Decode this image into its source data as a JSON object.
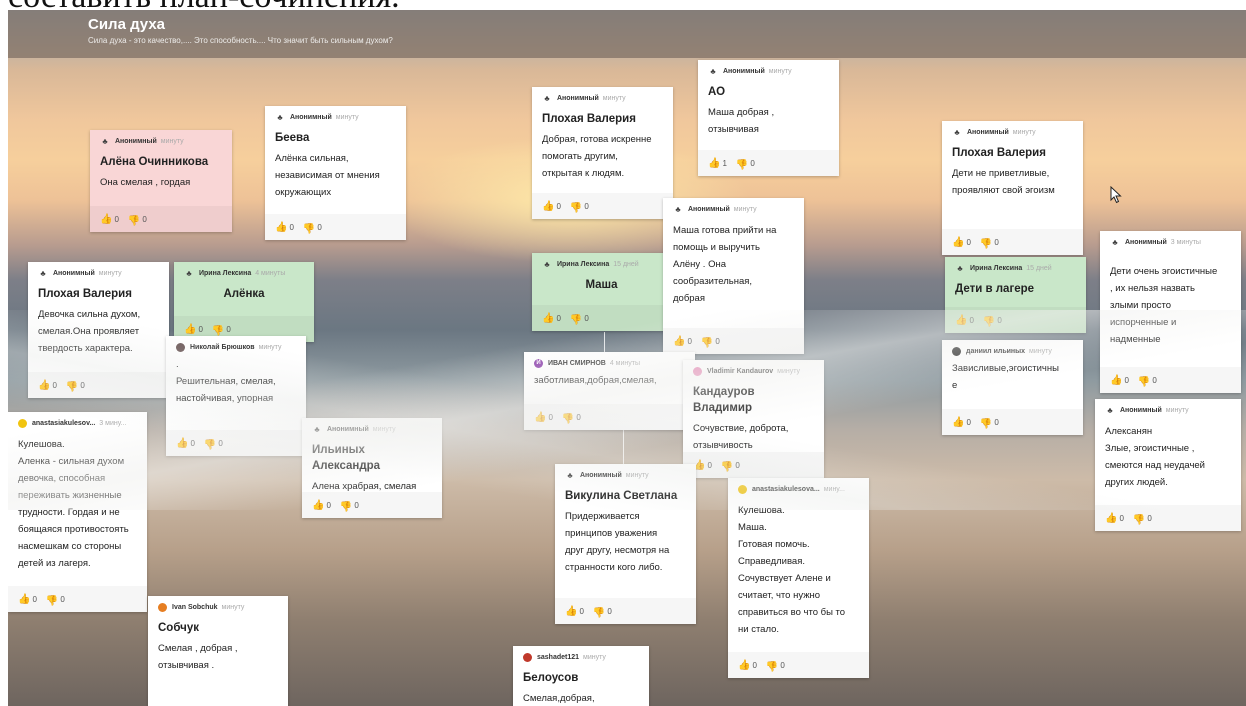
{
  "page_caption": "составить план-сочинения.",
  "board": {
    "title": "Сила духа",
    "subtitle": "Сила духа - это качество,.... Это способность.... Что значит быть сильным духом?"
  },
  "cards": [
    {
      "id": "c1",
      "author": "Анонимный",
      "time": "минуту",
      "title": "Алёна Очинникова",
      "body": "Она смелая , гордая",
      "likes": "0",
      "dislikes": "0"
    },
    {
      "id": "c2",
      "author": "Анонимный",
      "time": "минуту",
      "title": "Беева",
      "body": "Алёнка сильная,\nнезависимая от мнения\nокружающих",
      "likes": "0",
      "dislikes": "0"
    },
    {
      "id": "c3",
      "author": "Анонимный",
      "time": "минуту",
      "title": "Плохая Валерия",
      "body": "Добрая, готова искренне\nпомогать другим,\nоткрытая к людям.",
      "likes": "0",
      "dislikes": "0"
    },
    {
      "id": "c4",
      "author": "Анонимный",
      "time": "минуту",
      "title": "АО",
      "body": "Маша добрая ,\nотзывчивая",
      "likes": "1",
      "dislikes": "0"
    },
    {
      "id": "c5",
      "author": "Анонимный",
      "time": "минуту",
      "title": "Плохая Валерия",
      "body": "Дети не приветливые,\nпроявляют свой эгоизм",
      "likes": "0",
      "dislikes": "0"
    },
    {
      "id": "c6",
      "author": "Анонимный",
      "time": "минуту",
      "title": "Плохая Валерия",
      "body": "Девочка сильна духом,\nсмелая.Она проявляет\nтвердость характера.",
      "likes": "0",
      "dislikes": "0"
    },
    {
      "id": "c7",
      "author": "Ирина Лексина",
      "time": "4 минуты",
      "title": "Алёнка",
      "body": "",
      "likes": "0",
      "dislikes": "0"
    },
    {
      "id": "c8",
      "author": "Николай Брюшков",
      "time": "минуту",
      "title": "",
      "body": ".\nРешительная, смелая,\nнастойчивая, упорная",
      "likes": "0",
      "dislikes": "0"
    },
    {
      "id": "c9",
      "author": "Ирина Лексина",
      "time": "15 дней",
      "title": "Маша",
      "body": "",
      "likes": "0",
      "dislikes": "0"
    },
    {
      "id": "c10",
      "author": "Анонимный",
      "time": "минуту",
      "title": "",
      "body": "Маша готова прийти на\nпомощь и выручить\nАлёну . Она\nсообразительная,\nдобрая",
      "likes": "0",
      "dislikes": "0"
    },
    {
      "id": "c11",
      "author": "Ирина Лексина",
      "time": "15 дней",
      "title": "Дети в лагере",
      "body": "",
      "likes": "0",
      "dislikes": "0"
    },
    {
      "id": "c12",
      "author": "Анонимный",
      "time": "3 минуты",
      "title": "",
      "body": "Дети очень эгоистичные\n, их нельзя назвать\nзлыми просто\nиспорченные и\nнадменные",
      "likes": "0",
      "dislikes": "0"
    },
    {
      "id": "c13",
      "author": "даниил ильиных",
      "time": "минуту",
      "title": "",
      "body": "Зависливые,эгоистичны\nе",
      "likes": "0",
      "dislikes": "0"
    },
    {
      "id": "c14",
      "author": "ИВАН СМИРНОВ",
      "time": "4 минуты",
      "title": "",
      "body": "заботливая,добрая,смелая,",
      "likes": "0",
      "dislikes": "0"
    },
    {
      "id": "c15",
      "author": "Vladimir Kandaurov",
      "time": "минуту",
      "title": "Кандауров Владимир",
      "body": "Сочувствие, доброта,\nотзывчивость",
      "likes": "0",
      "dislikes": "0"
    },
    {
      "id": "c16",
      "author": "anastasiakulesov...",
      "time": "3 мину...",
      "title": "",
      "body": "Кулешова.\nАленка - сильная духом\nдевочка, способная\nпереживать жизненные\nтрудности.  Гордая и не\nбоящаяся противостоять\nнасмешкам со стороны\nдетей из лагеря.",
      "likes": "0",
      "dislikes": "0"
    },
    {
      "id": "c17",
      "author": "Анонимный",
      "time": "минуту",
      "title": "Ильиных Александра",
      "body": "Алена храбрая,  смелая",
      "likes": "0",
      "dislikes": "0"
    },
    {
      "id": "c18",
      "author": "Анонимный",
      "time": "минуту",
      "title": "Викулина Светлана",
      "body": "Придерживается\nпринципов уважения\nдруг другу, несмотря на\nстранности кого либо.",
      "likes": "0",
      "dislikes": "0"
    },
    {
      "id": "c19",
      "author": "anastasiakulesova...",
      "time": "мину...",
      "title": "",
      "body": "Кулешова.\nМаша.\nГотовая помочь.\nСправедливая.\nСочувствует Алене и\nсчитает, что нужно\nсправиться во что бы то\nни стало.",
      "likes": "0",
      "dislikes": "0"
    },
    {
      "id": "c20",
      "author": "Анонимный",
      "time": "минуту",
      "title": "",
      "body": "Алексанян\n Злые, эгоистичные ,\nсмеются над неудачей\nдругих людей.",
      "likes": "0",
      "dislikes": "0"
    },
    {
      "id": "c21",
      "author": "Ivan Sobchuk",
      "time": "минуту",
      "title": "Собчук",
      "body": "Смелая , добрая ,\nотзывчивая .",
      "likes": "",
      "dislikes": ""
    },
    {
      "id": "c22",
      "author": "sashadet121",
      "time": "минуту",
      "title": "Белоусов",
      "body": "Смелая,добрая,",
      "likes": "",
      "dislikes": ""
    }
  ],
  "icons": {
    "like": "thumbs-up-icon",
    "dislike": "thumbs-down-icon",
    "anon": "anonymous-avatar-icon"
  }
}
